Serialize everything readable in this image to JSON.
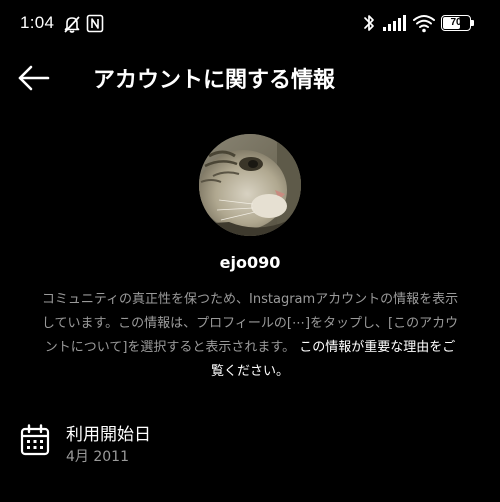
{
  "status_bar": {
    "time": "1:04",
    "battery_percent": "70",
    "battery_level": 0.7,
    "icons": [
      "notifications-off-icon",
      "nfc-icon",
      "bluetooth-icon",
      "signal-icon",
      "wifi-icon",
      "battery-icon"
    ]
  },
  "header": {
    "back_icon": "arrow-left-icon",
    "title": "アカウントに関する情報"
  },
  "profile": {
    "username": "ejo090",
    "description": "コミュニティの真正性を保つため、Instagramアカウントの情報を表示しています。この情報は、プロフィールの[⋯]をタップし、[このアカウントについて]を選択すると表示されます。",
    "link_text": "この情報が重要な理由をご覧ください。"
  },
  "info_items": [
    {
      "icon": "calendar-icon",
      "label": "利用開始日",
      "value": "4月 2011"
    }
  ],
  "colors": {
    "background": "#000000",
    "primary_text": "#ffffff",
    "secondary_text": "#9a9a9a"
  }
}
